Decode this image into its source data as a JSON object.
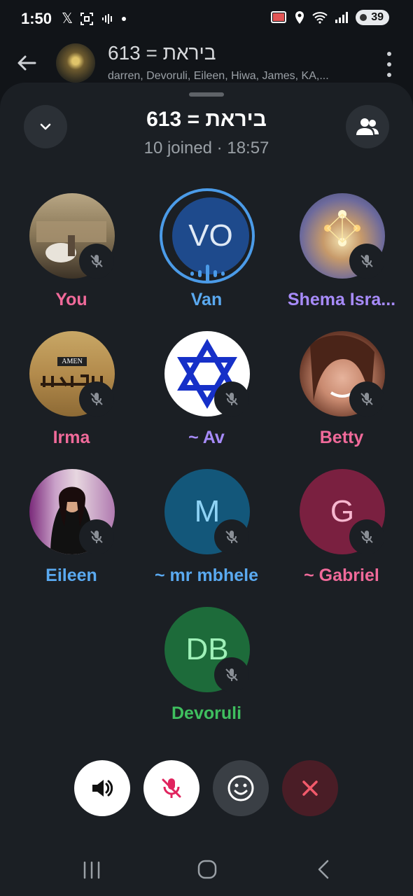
{
  "status_bar": {
    "time": "1:50",
    "battery": "39"
  },
  "chat_header": {
    "title": "ביראת = 613",
    "members": "darren, Devoruli, Eileen, Hiwa, James, KA,..."
  },
  "call": {
    "title": "ביראת = 613",
    "subtitle": "10 joined · 18:57"
  },
  "participants": [
    {
      "name": "You",
      "name_color": "#f06a9a",
      "avatar": "photo",
      "muted": true
    },
    {
      "name": "Van",
      "name_color": "#5aa9f0",
      "initials": "VO",
      "avatar_color": "#1e4a8c",
      "speaking": true
    },
    {
      "name": "Shema Isra...",
      "name_color": "#a78bfa",
      "avatar": "photo",
      "muted": true
    },
    {
      "name": "Irma",
      "name_color": "#f06a9a",
      "avatar": "photo",
      "avatar_caption": "AMEN",
      "muted": true
    },
    {
      "name": "~ Av",
      "name_color": "#a78bfa",
      "avatar": "star-of-david",
      "muted": true
    },
    {
      "name": "Betty",
      "name_color": "#f06a9a",
      "avatar": "photo",
      "muted": true
    },
    {
      "name": "Eileen",
      "name_color": "#5aa9f0",
      "avatar": "photo",
      "muted": true
    },
    {
      "name": "~ mr mbhele",
      "name_color": "#5aa9f0",
      "initials": "M",
      "avatar_color": "#13577a",
      "muted": true
    },
    {
      "name": "~ Gabriel",
      "name_color": "#f06a9a",
      "initials": "G",
      "avatar_color": "#7a2040",
      "muted": true
    },
    {
      "name": "Devoruli",
      "name_color": "#3fbf5f",
      "initials": "DB",
      "avatar_color": "#1d6b3a",
      "muted": true
    }
  ],
  "controls": {
    "speaker_color": "#ffffff",
    "mute_color": "#ffffff",
    "emoji_color": "#3a3f45",
    "leave_color": "#4a1d26"
  }
}
